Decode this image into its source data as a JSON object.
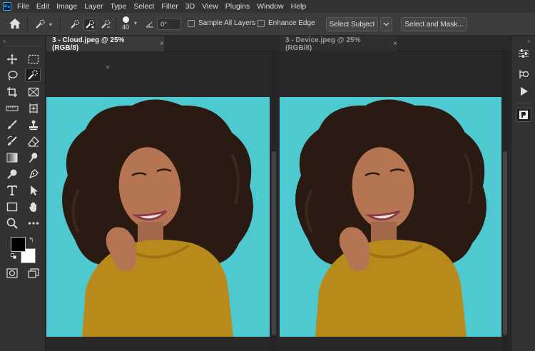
{
  "app": {
    "logo": "Ps"
  },
  "menu": [
    "File",
    "Edit",
    "Image",
    "Layer",
    "Type",
    "Select",
    "Filter",
    "3D",
    "View",
    "Plugins",
    "Window",
    "Help"
  ],
  "options": {
    "brush_size": "40",
    "angle_value": "0°",
    "sample_all_layers": "Sample All Layers",
    "enhance_edge": "Enhance Edge",
    "select_subject": "Select Subject",
    "select_and_mask": "Select and Mask..."
  },
  "documents": [
    {
      "title": "3 - Cloud.jpeg @ 25% (RGB/8)",
      "close": "×",
      "active": true
    },
    {
      "title": "3 - Device.jpeg @ 25% (RGB/8)",
      "close": "×",
      "active": false
    }
  ],
  "colors": {
    "background_teal": "#4fc9d0",
    "sweater": "#b88a1c",
    "hair": "#2a1a12",
    "skin": "#b57553"
  },
  "icons": {
    "home": "home-icon",
    "tools": [
      "move-icon",
      "marquee-icon",
      "lasso-icon",
      "quick-selection-icon",
      "crop-icon",
      "frame-icon",
      "ruler-icon",
      "healing-icon",
      "brush-icon",
      "stamp-icon",
      "history-brush-icon",
      "eraser-icon",
      "gradient-icon",
      "smudge-icon",
      "dodge-icon",
      "pen-icon",
      "type-icon",
      "path-select-icon",
      "rectangle-icon",
      "hand-icon",
      "zoom-icon",
      "more-icon"
    ]
  }
}
